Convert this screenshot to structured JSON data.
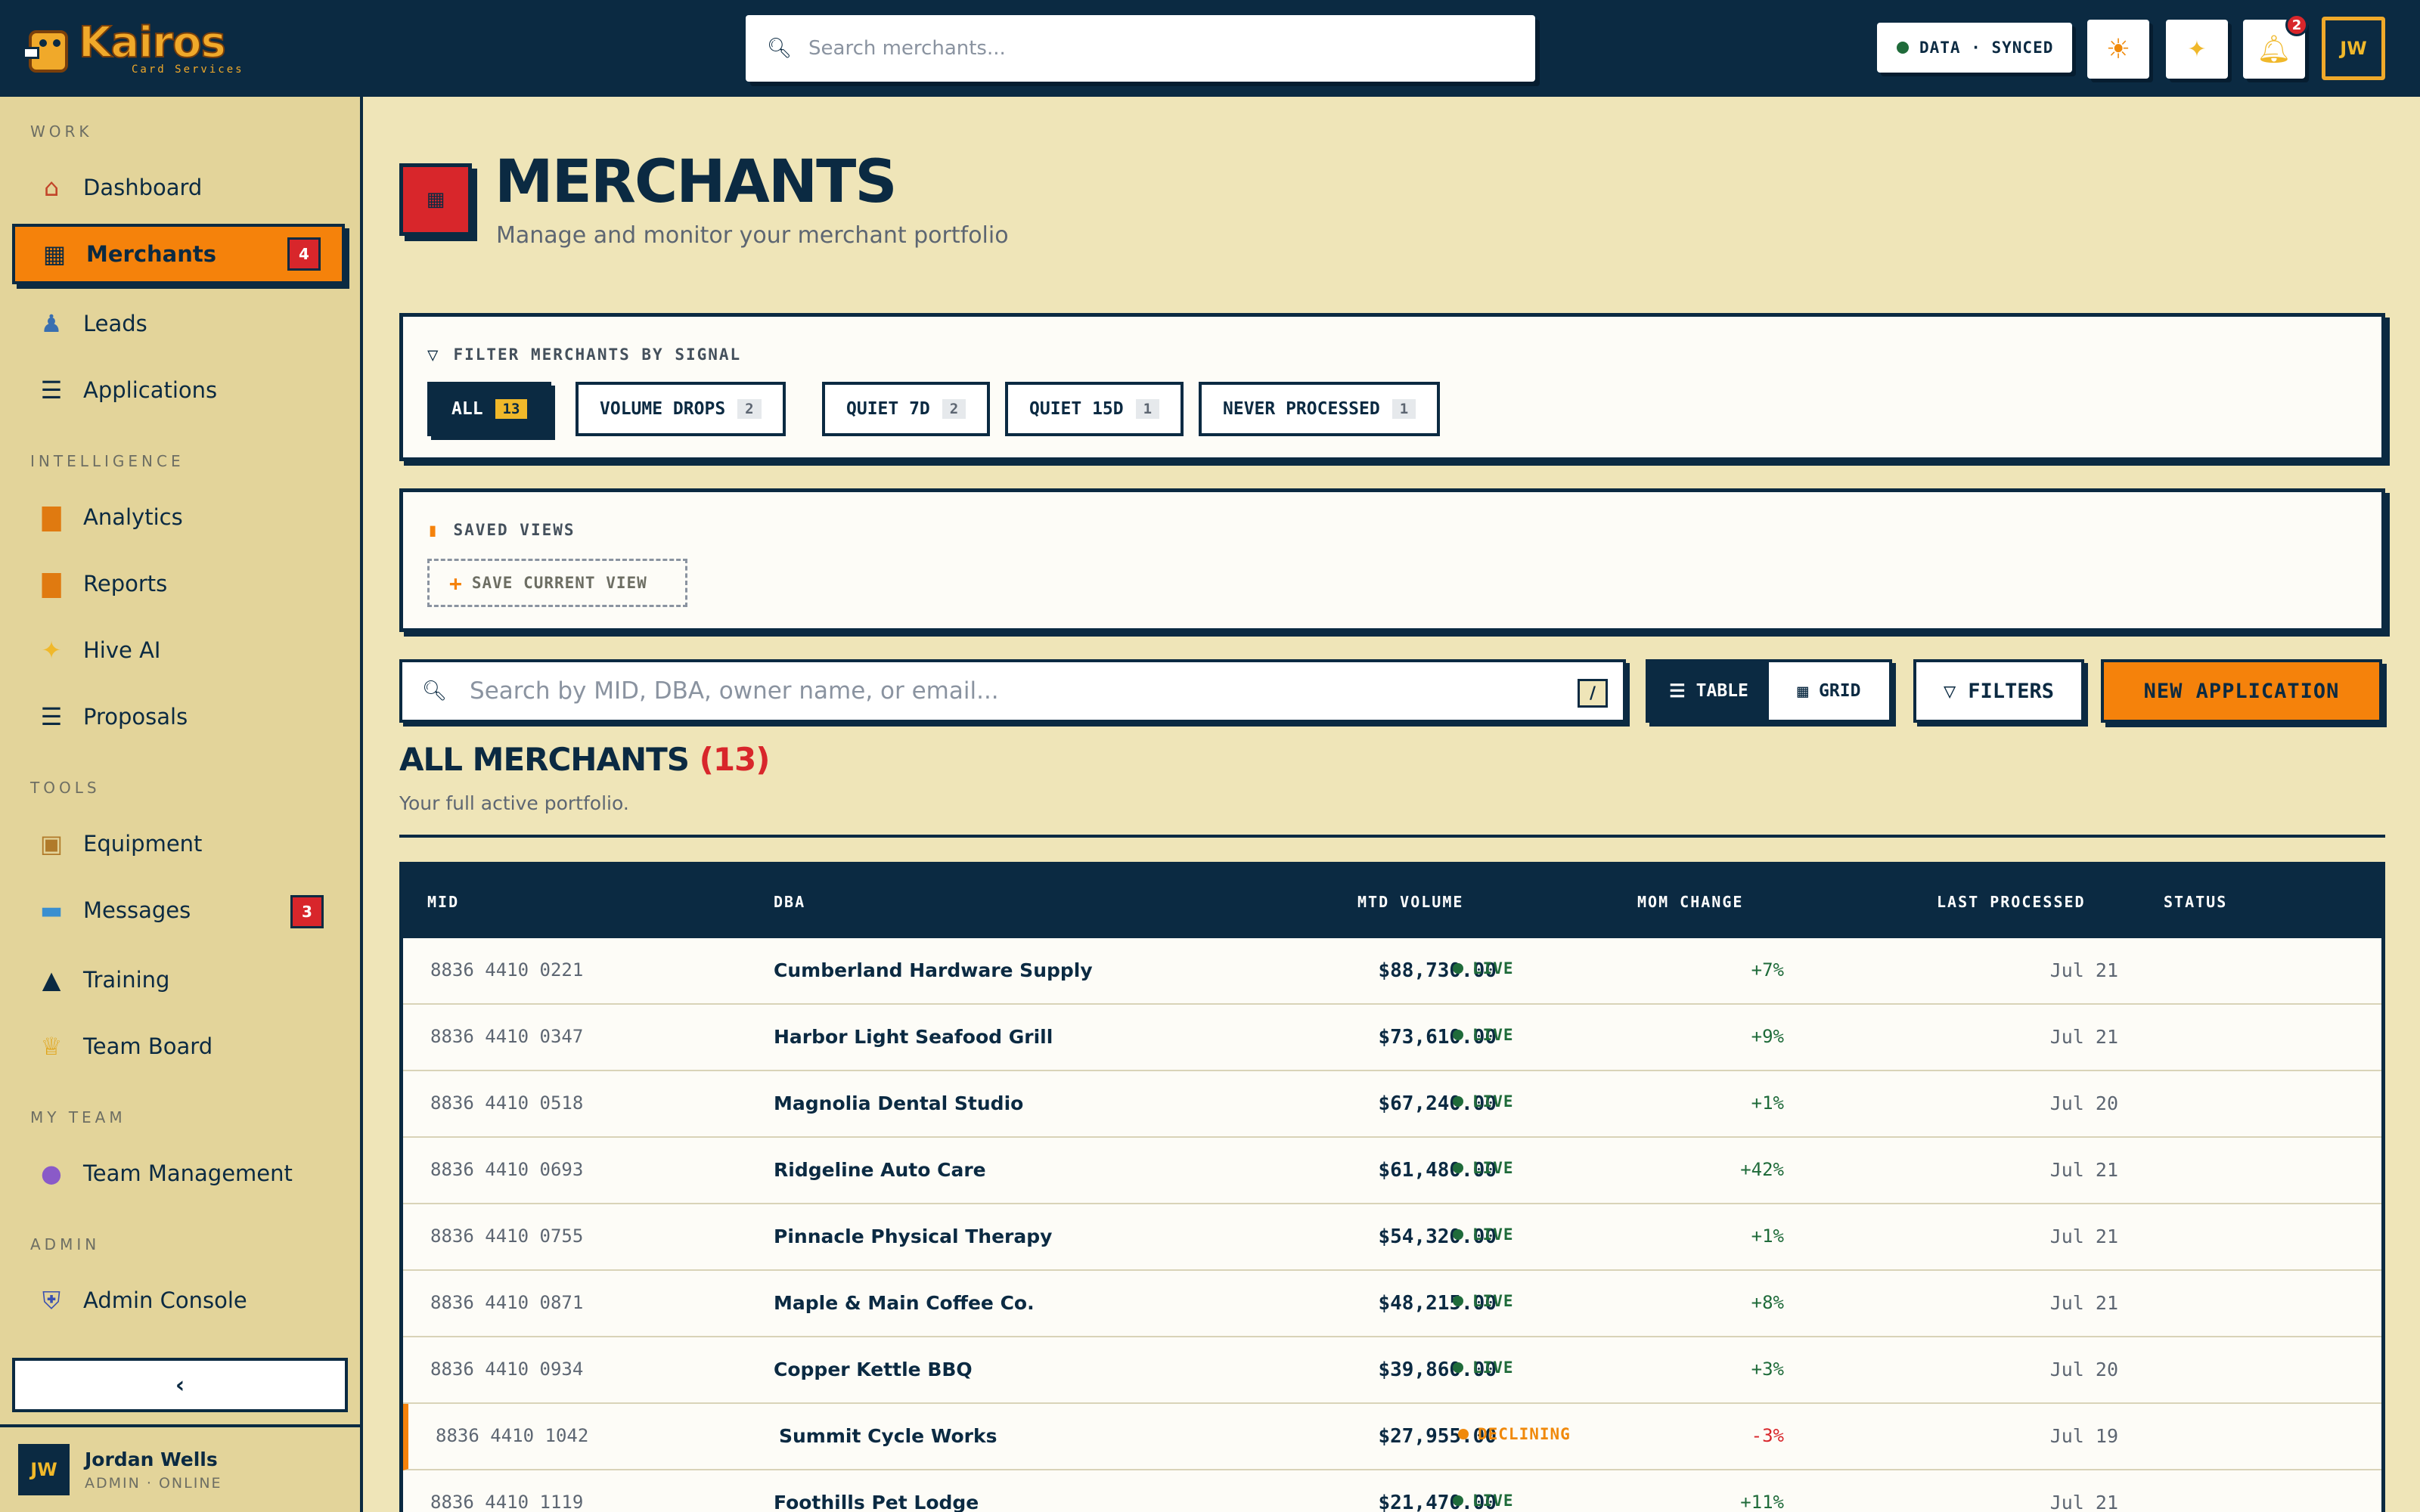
{
  "brand": {
    "name": "Kairos",
    "tagline": "Card Services"
  },
  "topbar": {
    "search_placeholder": "Search merchants...",
    "sync_status": "DATA · SYNCED",
    "notifications_count": "2",
    "user_initials": "JW"
  },
  "sidebar": {
    "sections": [
      {
        "label": "WORK"
      },
      {
        "label": "INTELLIGENCE"
      },
      {
        "label": "TOOLS"
      },
      {
        "label": "MY TEAM"
      },
      {
        "label": "ADMIN"
      }
    ],
    "items": [
      {
        "label": "Dashboard",
        "icon": "house-icon"
      },
      {
        "label": "Merchants",
        "icon": "storefront-icon",
        "badge": "4",
        "active": true
      },
      {
        "label": "Leads",
        "icon": "person-icon"
      },
      {
        "label": "Applications",
        "icon": "document-icon"
      },
      {
        "label": "Analytics",
        "icon": "bar-chart-icon"
      },
      {
        "label": "Reports",
        "icon": "bar-chart-icon"
      },
      {
        "label": "Hive AI",
        "icon": "sparkle-icon"
      },
      {
        "label": "Proposals",
        "icon": "document-icon"
      },
      {
        "label": "Equipment",
        "icon": "toolbox-icon"
      },
      {
        "label": "Messages",
        "icon": "chat-icon",
        "badge": "3"
      },
      {
        "label": "Training",
        "icon": "graduation-cap-icon"
      },
      {
        "label": "Team Board",
        "icon": "trophy-icon"
      },
      {
        "label": "Team Management",
        "icon": "people-icon"
      },
      {
        "label": "Admin Console",
        "icon": "shield-icon"
      }
    ],
    "user": {
      "initials": "JW",
      "name": "Jordan Wells",
      "role": "ADMIN · ONLINE"
    }
  },
  "page": {
    "title": "MERCHANTS",
    "subtitle": "Manage and monitor your merchant portfolio"
  },
  "signal_filter": {
    "heading": "FILTER MERCHANTS BY SIGNAL",
    "chips": [
      {
        "label": "ALL",
        "count": "13",
        "active": true
      },
      {
        "label": "VOLUME DROPS",
        "count": "2"
      },
      {
        "label": "QUIET 7D",
        "count": "2"
      },
      {
        "label": "QUIET 15D",
        "count": "1"
      },
      {
        "label": "NEVER PROCESSED",
        "count": "1"
      }
    ]
  },
  "saved_views": {
    "heading": "SAVED VIEWS",
    "save_button": "SAVE CURRENT VIEW"
  },
  "toolbar": {
    "search_placeholder": "Search by MID, DBA, owner name, or email...",
    "shortcut_key": "/",
    "view_table": "TABLE",
    "view_grid": "GRID",
    "filters": "FILTERS",
    "new_application": "NEW APPLICATION"
  },
  "list": {
    "title": "ALL MERCHANTS",
    "count": "(13)",
    "subtitle": "Your full active portfolio."
  },
  "table": {
    "columns": [
      "MID",
      "DBA",
      "MTD VOLUME",
      "MOM CHANGE",
      "LAST PROCESSED",
      "STATUS"
    ],
    "rows": [
      {
        "mid": "8836 4410 0221",
        "dba": "Cumberland Hardware Supply",
        "volume": "$88,730.00",
        "mom": "+7%",
        "last": "Jul 21",
        "status": "LIVE"
      },
      {
        "mid": "8836 4410 0347",
        "dba": "Harbor Light Seafood Grill",
        "volume": "$73,610.00",
        "mom": "+9%",
        "last": "Jul 21",
        "status": "LIVE"
      },
      {
        "mid": "8836 4410 0518",
        "dba": "Magnolia Dental Studio",
        "volume": "$67,240.00",
        "mom": "+1%",
        "last": "Jul 20",
        "status": "LIVE"
      },
      {
        "mid": "8836 4410 0693",
        "dba": "Ridgeline Auto Care",
        "volume": "$61,480.00",
        "mom": "+42%",
        "last": "Jul 21",
        "status": "LIVE"
      },
      {
        "mid": "8836 4410 0755",
        "dba": "Pinnacle Physical Therapy",
        "volume": "$54,320.00",
        "mom": "+1%",
        "last": "Jul 21",
        "status": "LIVE"
      },
      {
        "mid": "8836 4410 0871",
        "dba": "Maple & Main Coffee Co.",
        "volume": "$48,215.00",
        "mom": "+8%",
        "last": "Jul 21",
        "status": "LIVE"
      },
      {
        "mid": "8836 4410 0934",
        "dba": "Copper Kettle BBQ",
        "volume": "$39,860.00",
        "mom": "+3%",
        "last": "Jul 20",
        "status": "LIVE"
      },
      {
        "mid": "8836 4410 1042",
        "dba": "Summit Cycle Works",
        "volume": "$27,955.00",
        "mom": "-3%",
        "last": "Jul 19",
        "status": "DECLINING"
      },
      {
        "mid": "8836 4410 1119",
        "dba": "Foothills Pet Lodge",
        "volume": "$21,470.00",
        "mom": "+11%",
        "last": "Jul 21",
        "status": "LIVE"
      }
    ]
  },
  "colors": {
    "navy": "#0b2a42",
    "orange": "#f5820b",
    "red": "#d8262b",
    "cream": "#efe5b8",
    "green": "#1f6b3a"
  }
}
